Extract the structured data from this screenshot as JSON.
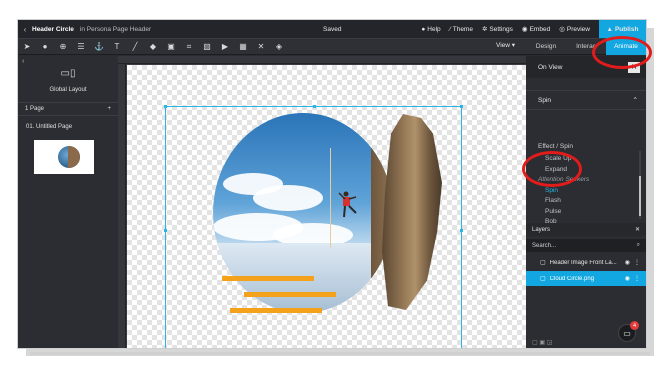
{
  "topbar": {
    "back_icon": "chevron-left-icon",
    "title": "Header Circle",
    "subtitle": "in Persona Page Header",
    "status": "Saved",
    "help": "Help",
    "theme": "Theme",
    "settings": "Settings",
    "embed": "Embed",
    "preview": "Preview",
    "publish": "Publish"
  },
  "toolbar": {
    "tools": [
      "cursor-icon",
      "blob-icon",
      "zoom-icon",
      "align-icon",
      "anchor-icon",
      "text-icon",
      "line-icon",
      "shape-icon",
      "box-icon",
      "crop-icon",
      "image-icon",
      "video-icon",
      "widget-icon",
      "expand-icon",
      "layers-stack-icon"
    ],
    "view_label": "View ▾"
  },
  "right_tabs": [
    "Design",
    "Interac",
    "Animate"
  ],
  "left_panel": {
    "layout_label": "Global Layout",
    "pages_count": "1 Page",
    "add": "+",
    "page_name": "01. Untitled Page"
  },
  "right_panel": {
    "on_view": "On View",
    "close": "✕",
    "spin_header": "Spin",
    "chevron": "⌃",
    "effect_label": "Effect / Spin",
    "effects": [
      {
        "label": "Scale Up",
        "kind": "item"
      },
      {
        "label": "Expand",
        "kind": "item"
      },
      {
        "label": "Attention Seekers",
        "kind": "category"
      },
      {
        "label": "Spin",
        "kind": "selected"
      },
      {
        "label": "Flash",
        "kind": "item"
      },
      {
        "label": "Pulse",
        "kind": "item"
      },
      {
        "label": "Bob",
        "kind": "item"
      }
    ],
    "layers_title": "Layers",
    "layers_close": "✕",
    "search_placeholder": "Search...",
    "layers": [
      {
        "name": "Header Image Front La...",
        "active": false
      },
      {
        "name": "Cloud Circle.png",
        "active": true
      }
    ],
    "chat_badge": "4"
  },
  "colors": {
    "accent": "#12a7e0",
    "orange_bars": "#f4a21c",
    "annotation": "#e21b1b"
  }
}
